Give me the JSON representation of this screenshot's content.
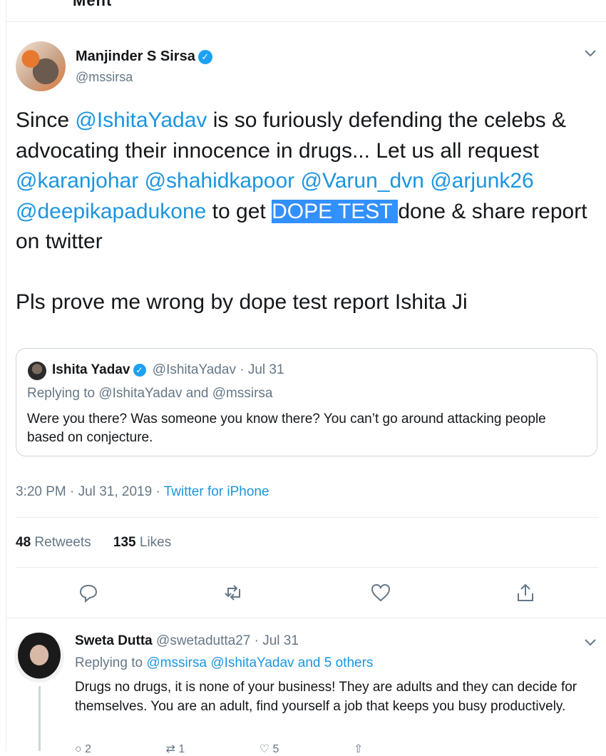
{
  "clipped_header": "Ment",
  "tweet": {
    "author_name": "Manjinder S Sirsa",
    "author_handle": "@mssirsa",
    "text_before1": "Since ",
    "mention_ishita": "@IshitaYadav",
    "text_after1": " is so furiously defending the celebs & advocating their innocence in drugs... Let us all request ",
    "mention_karan": "@karanjohar",
    "mention_shahid": "@shahidkapoor",
    "mention_varun": "@Varun_dvn",
    "mention_arjun": "@arjunk26",
    "mention_deepika": "@deepikapadukone",
    "text_to_get": " to get ",
    "highlight": "DOPE TEST ",
    "text_after2": "done & share report on twitter",
    "text_line2": "Pls prove me wrong by dope test report Ishita Ji",
    "time": "3:20 PM · Jul 31, 2019 · ",
    "source": "Twitter for iPhone",
    "retweets_count": "48",
    "retweets_label": " Retweets",
    "likes_count": "135",
    "likes_label": " Likes"
  },
  "quoted": {
    "name": "Ishita Yadav",
    "handle_date": "@IshitaYadav · Jul 31",
    "replying": "Replying to @IshitaYadav and @mssirsa",
    "text": "Were you there? Was someone you know there? You can’t go around attacking people based on conjecture."
  },
  "reply": {
    "name": "Sweta Dutta",
    "handle_date": " @swetadutta27 · Jul 31",
    "replying_prefix": "Replying to ",
    "replying_mentions": "@mssirsa @IshitaYadav and 5 others",
    "text": "Drugs no drugs, it is none of your business! They are adults and they can decide for themselves. You are an adult, find yourself a job that keeps you busy productively.",
    "reply_count": "2",
    "retweet_count": "1",
    "like_count": "5"
  },
  "icons": [
    "verified-badge-icon",
    "chevron-down-icon",
    "reply-icon",
    "retweet-icon",
    "like-icon",
    "share-icon"
  ],
  "colors": {
    "link": "#1b95e0",
    "verified": "#1da1f2",
    "highlight": "#3390ff",
    "muted": "#657786"
  }
}
